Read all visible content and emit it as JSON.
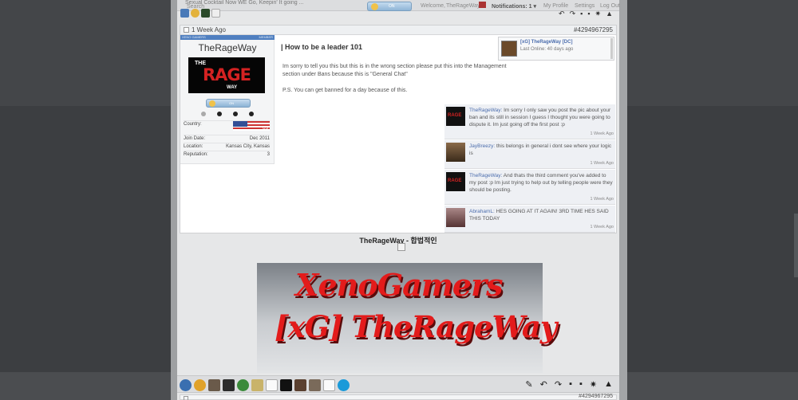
{
  "topbar": {
    "search_line": "Sexual Cocktail Now WE Go, Keepin' It going ...",
    "search_label": "Search",
    "online_label": "ON",
    "welcome_label": "Welcome,",
    "welcome_user": "TheRageWay",
    "notifications_label": "Notifications: 1 ▾",
    "my_profile": "My Profile",
    "settings": "Settings",
    "log_out": "Log Out"
  },
  "post": {
    "age": "1 Week Ago",
    "post_id": "#4294967295",
    "banner_left": "XENO GAMERS",
    "banner_right": "MEMBER",
    "username": "TheRageWay",
    "logo_the": "THE",
    "logo_rage": "RAGE",
    "logo_way": "WAY",
    "status_label": "ON",
    "country_label": "Country:",
    "country_code": "US",
    "details": [
      {
        "k": "Join Date:",
        "v": "Dec 2011"
      },
      {
        "k": "Location:",
        "v": "Kansas City, Kansas"
      },
      {
        "k": "Reputation:",
        "v": "3"
      }
    ],
    "title": "| How to be a leader 101",
    "body": [
      "Im sorry to tell you this but this is in the wrong section please put this into the Management section under Bans because this is \"General Chat\"",
      "P.S. You can get banned for a day because of this."
    ],
    "mini_profile": {
      "name": "[xG] TheRageWay [DC]",
      "online": "Last Online: 40 days ago"
    },
    "comments": [
      {
        "who": "TheRageWay:",
        "text": " Im sorry I only saw you post the pic about your ban and its still in session I guess I thought you were going to dispute it. Im just going off the first post :p",
        "when": "1 Week Ago"
      },
      {
        "who": "JayBreezy:",
        "text": " this belongs in general i dont see where your logic is",
        "when": "1 Week Ago"
      },
      {
        "who": "TheRageWay:",
        "text": " And thats the third comment you've added to my post :p Im just trying to help out by telling people were they should be posting.",
        "when": "1 Week Ago"
      },
      {
        "who": "AbrahamL:",
        "text": " HES GOING AT IT AGAIN! 3RD TIME HES SAID THIS TODAY",
        "when": "1 Week Ago"
      }
    ],
    "signature_title": "TheRageWay - 합법적인",
    "signature_banner": {
      "line1": "XenoGamers",
      "line2": "[xG] TheRageWay"
    }
  },
  "next_post_id": "#4294967295",
  "icons": {
    "top_tools": [
      "undo-icon",
      "redo-icon",
      "comment-icon",
      "comment-add-icon",
      "star-icon",
      "warning-icon"
    ],
    "bottom_tools": [
      "pencil-icon",
      "undo-icon",
      "redo-icon",
      "comment-icon",
      "comment-add-icon",
      "star-icon",
      "warning-icon"
    ]
  },
  "colors": {
    "link": "#4b6dad",
    "banner_blue": "#4f7fc0",
    "rage_red": "#d42222",
    "sig_red": "#e31b1b"
  }
}
